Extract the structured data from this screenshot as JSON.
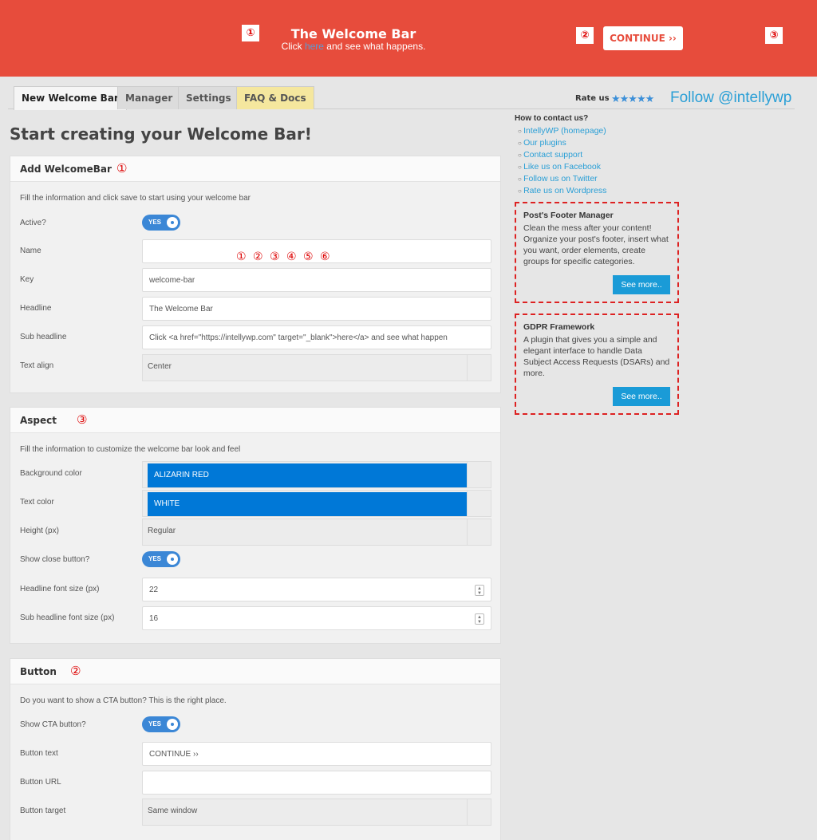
{
  "welcome_bar": {
    "headline": "The Welcome Bar",
    "sub_before": "Click ",
    "sub_link": "here",
    "sub_after": " and see what happens.",
    "cta_label": "CONTINUE ››",
    "markers": [
      "①",
      "②",
      "③"
    ],
    "background_color": "#e74c3c"
  },
  "tabs": [
    "New Welcome Bar",
    "Manager",
    "Settings",
    "FAQ & Docs"
  ],
  "rate": {
    "label": "Rate us",
    "stars": "★★★★★",
    "follow": "Follow @intellywp"
  },
  "page_title": "Start creating your Welcome Bar!",
  "add_panel": {
    "title": "Add WelcomeBar",
    "marker": "①",
    "description": "Fill the information and click save to start using your welcome bar",
    "active_label": "Active?",
    "active_toggle": "YES",
    "name_label": "Name",
    "name_numbers": "① ② ③ ④ ⑤ ⑥",
    "key_label": "Key",
    "key_value": "welcome-bar",
    "headline_label": "Headline",
    "headline_value": "The Welcome Bar",
    "subheadline_label": "Sub headline",
    "subheadline_value": "Click <a href=\"https://intellywp.com\" target=\"_blank\">here</a> and see what happen",
    "textalign_label": "Text align",
    "textalign_value": "Center"
  },
  "aspect_panel": {
    "title": "Aspect",
    "marker": "③",
    "description": "Fill the information to customize the welcome bar look and feel",
    "bg_label": "Background color",
    "bg_value": "ALIZARIN RED",
    "text_label": "Text color",
    "text_value": "WHITE",
    "height_label": "Height (px)",
    "height_value": "Regular",
    "close_label": "Show close button?",
    "close_toggle": "YES",
    "hfs_label": "Headline font size (px)",
    "hfs_value": "22",
    "shfs_label": "Sub headline font size (px)",
    "shfs_value": "16"
  },
  "button_panel": {
    "title": "Button",
    "marker": "②",
    "description": "Do you want to show a CTA button? This is the right place.",
    "show_label": "Show CTA button?",
    "show_toggle": "YES",
    "text_label": "Button text",
    "text_value": "CONTINUE ››",
    "url_label": "Button URL",
    "url_value": "",
    "target_label": "Button target",
    "target_value": "Same window"
  },
  "contact": {
    "title": "How to contact us?",
    "links": [
      "IntellyWP (homepage)",
      "Our plugins",
      "Contact support",
      "Like us on Facebook",
      "Follow us on Twitter",
      "Rate us on Wordpress"
    ]
  },
  "promos": [
    {
      "title": "Post's Footer Manager",
      "text": "Clean the mess after your content! Organize your post's footer, insert what you want, order elements, create groups for specific categories.",
      "button": "See more.."
    },
    {
      "title": "GDPR Framework",
      "text": "A plugin that gives you a simple and elegant interface to handle Data Subject Access Requests (DSARs) and more.",
      "button": "See more.."
    }
  ]
}
